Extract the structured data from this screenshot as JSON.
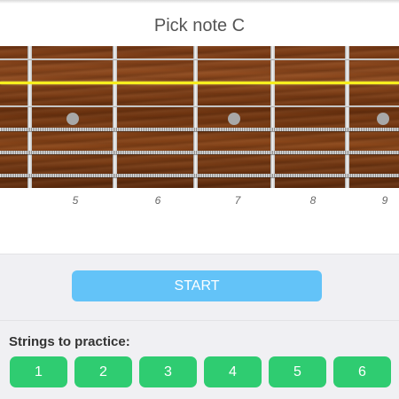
{
  "prompt": {
    "text": "Pick note C"
  },
  "fretboard": {
    "fret_numbers": [
      "5",
      "6",
      "7",
      "8",
      "9"
    ],
    "active_string_color": "#f7ef1e",
    "marker_color": "#a8a8a8"
  },
  "controls": {
    "start_label": "START",
    "start_color": "#63c3f8"
  },
  "strings_practice": {
    "label": "Strings to practice:",
    "button_color": "#2fcc71",
    "buttons": [
      "1",
      "2",
      "3",
      "4",
      "5",
      "6"
    ]
  }
}
